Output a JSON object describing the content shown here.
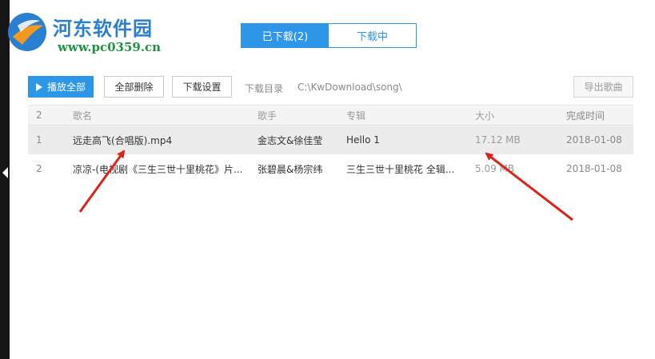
{
  "watermark": {
    "title": "河东软件园",
    "url": "www.pc0359.cn"
  },
  "tabs": [
    {
      "label": "已下载(2)",
      "active": true
    },
    {
      "label": "下载中",
      "active": false
    }
  ],
  "toolbar": {
    "play_all": "播放全部",
    "delete_all": "全部删除",
    "download_settings": "下载设置",
    "download_dir_label": "下载目录",
    "download_dir_path": "C:\\KwDownload\\song\\",
    "export_songs": "导出歌曲"
  },
  "table": {
    "columns": {
      "index": "2",
      "name": "歌名",
      "artist": "歌手",
      "album": "专辑",
      "size": "大小",
      "completed": "完成时间"
    },
    "rows": [
      {
        "index": "1",
        "name": "远走高飞(合唱版).mp4",
        "artist": "金志文&徐佳莹",
        "album": "Hello 1",
        "size": "17.12 MB",
        "completed": "2018-01-08"
      },
      {
        "index": "2",
        "name": "凉凉-(电视剧《三生三世十里桃花》片...",
        "artist": "张碧晨&杨宗纬",
        "album": "三生三世十里桃花 全辑...",
        "size": "5.09 MB",
        "completed": "2018-01-08"
      }
    ]
  },
  "colors": {
    "accent": "#2d96e6",
    "annotation_arrow": "#d9241c",
    "selected_row": "#ececec"
  }
}
